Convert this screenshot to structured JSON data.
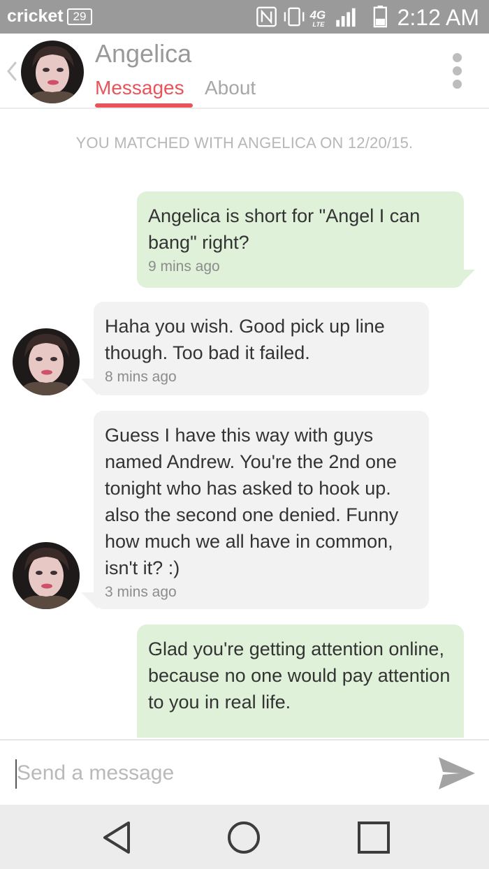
{
  "status_bar": {
    "carrier": "cricket",
    "notification_count": "29",
    "network": "4G LTE",
    "time": "2:12 AM"
  },
  "header": {
    "name": "Angelica",
    "tabs": [
      {
        "label": "Messages",
        "active": true
      },
      {
        "label": "About",
        "active": false
      }
    ]
  },
  "match_note": "YOU MATCHED WITH ANGELICA ON 12/20/15.",
  "messages": [
    {
      "from": "me",
      "text": "Angelica is short for \"Angel I can bang\" right?",
      "time": "9 mins ago"
    },
    {
      "from": "them",
      "text": "Haha you wish. Good pick up line though. Too bad it failed.",
      "time": "8 mins ago"
    },
    {
      "from": "them",
      "text": "Guess I have this way with guys named Andrew. You're the 2nd one tonight who has asked to hook up. also the second one denied. Funny how much we all have in common, isn't it? :)",
      "time": "3 mins ago"
    },
    {
      "from": "me",
      "text": "Glad you're getting attention online, because no one would pay attention to you in real life.",
      "time": ""
    }
  ],
  "composer": {
    "placeholder": "Send a message",
    "value": ""
  },
  "colors": {
    "accent": "#e9545a",
    "sent_bubble": "#dff1d9",
    "received_bubble": "#f2f2f2",
    "status_bar": "#9a9a9a",
    "nav_bar": "#ececec"
  },
  "icons": [
    "back-icon",
    "overflow-menu-icon",
    "send-icon",
    "nav-back-icon",
    "nav-home-icon",
    "nav-recents-icon",
    "nfc-icon",
    "signal-icon",
    "battery-icon"
  ]
}
